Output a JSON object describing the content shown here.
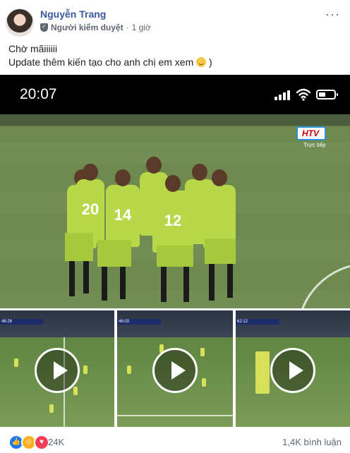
{
  "post": {
    "author": "Nguyễn Trang",
    "role": "Người kiểm duyệt",
    "separator": "·",
    "time": "1 giờ",
    "more": "···",
    "text_line1": "Chờ mãiiiiii",
    "text_line2": "Update thêm kiến tạo cho anh chị em xem",
    "text_line2_end": ")"
  },
  "phone_status": {
    "time": "20:07"
  },
  "photo": {
    "broadcaster": "HTV",
    "broadcaster_sub": "Trực tiếp",
    "jersey_numbers": [
      "20",
      "14",
      "12"
    ]
  },
  "videos": [
    {
      "score": "46:28"
    },
    {
      "score": "46:03"
    },
    {
      "score": "62:12"
    }
  ],
  "footer": {
    "reaction_count": "24K",
    "comments": "1,4K bình luận"
  },
  "colors": {
    "name_link": "#385898",
    "like": "#2078f4",
    "love": "#f33e58",
    "haha": "#f7b125"
  }
}
